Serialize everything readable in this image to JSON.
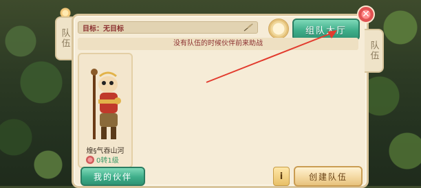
{
  "left_tab": {
    "label": "队伍"
  },
  "right_tab": {
    "label": "队伍"
  },
  "goal": {
    "text": "目标：无目标"
  },
  "buttons": {
    "team_hall": "组队大厅",
    "my_partner": "我的伙伴",
    "create_team": "创建队伍"
  },
  "hint": {
    "text": "没有队伍的时候伙伴前来助战"
  },
  "member": {
    "name": "煌§气吞山河",
    "level": "0转1级"
  },
  "colors": {
    "accent_green": "#3fae8a",
    "panel_bg": "#f6ecd7",
    "hint_text": "#8b2f2f",
    "annotation_arrow": "#e23b2e"
  },
  "icons": {
    "close": "close-icon",
    "feather": "feather-icon",
    "badge": "badge-icon",
    "help": "help-icon",
    "level": "level-icon"
  }
}
